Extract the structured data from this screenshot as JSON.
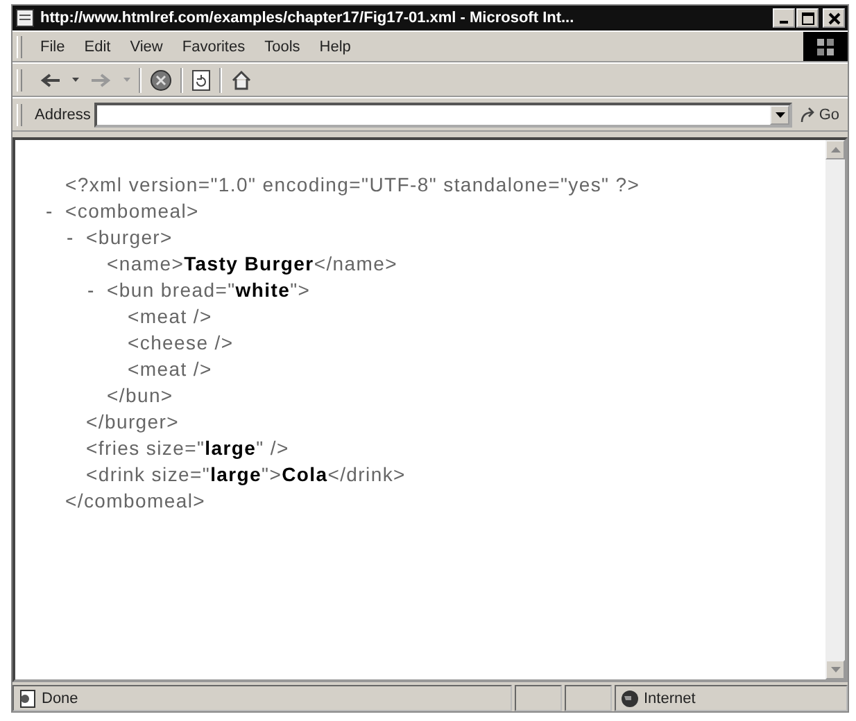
{
  "window": {
    "title": "http://www.htmlref.com/examples/chapter17/Fig17-01.xml - Microsoft Int..."
  },
  "menu": [
    "File",
    "Edit",
    "View",
    "Favorites",
    "Tools",
    "Help"
  ],
  "address": {
    "label": "Address",
    "go": "Go"
  },
  "document": [
    {
      "text": "<?xml version=\"1.0\" encoding=\"UTF-8\" standalone=\"yes\" ?>"
    },
    {
      "toggle": "-",
      "text": "<combomeal>",
      "close": "</combomeal>",
      "children": [
        {
          "toggle": "-",
          "text": "<burger>",
          "close": "</burger>",
          "children": [
            {
              "text": "<name>**Tasty Burger**</name>"
            },
            {
              "toggle": "-",
              "text": "<bun bread=\"**white**\">",
              "close": "</bun>",
              "children": [
                {
                  "text": "<meat />"
                },
                {
                  "text": "<cheese />"
                },
                {
                  "text": "<meat />"
                }
              ]
            }
          ]
        },
        {
          "text": "<fries size=\"**large**\" />"
        },
        {
          "text": "<drink size=\"**large**\">**Cola**</drink>"
        }
      ]
    }
  ],
  "status_bar": {
    "text": "Done",
    "zone": "Internet"
  }
}
